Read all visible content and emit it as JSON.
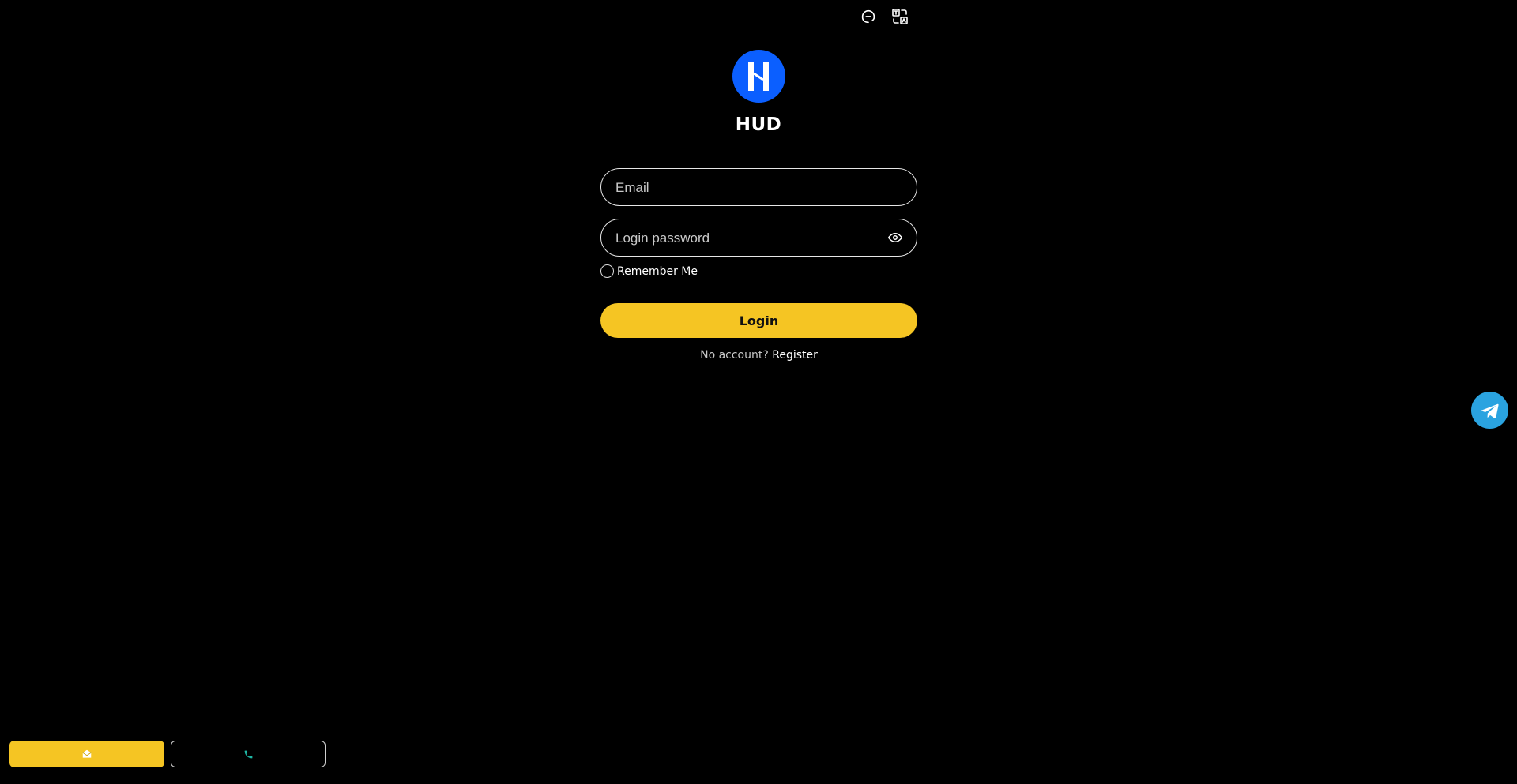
{
  "header": {
    "support_icon": "headset-icon",
    "language_icon": "globe-translate-icon"
  },
  "brand": {
    "name": "HUD",
    "logo_color": "#0b5fff"
  },
  "form": {
    "email_placeholder": "Email",
    "password_placeholder": "Login password",
    "remember_label": "Remember Me",
    "login_label": "Login",
    "no_account_text": "No account?",
    "register_label": "Register"
  },
  "floating": {
    "telegram_icon": "telegram-icon"
  },
  "bottom_bar": {
    "left_icon": "envelope-open-icon",
    "right_icon": "phone-icon"
  },
  "colors": {
    "accent": "#f5c523",
    "background": "#000000",
    "telegram": "#2aa3e0"
  }
}
